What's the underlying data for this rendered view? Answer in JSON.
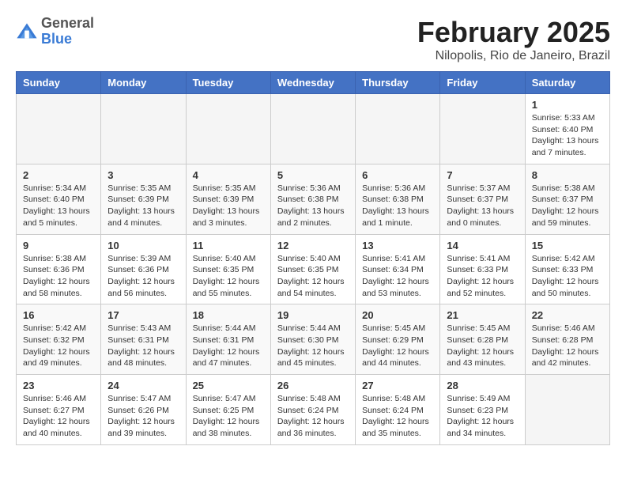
{
  "header": {
    "logo_general": "General",
    "logo_blue": "Blue",
    "title": "February 2025",
    "subtitle": "Nilopolis, Rio de Janeiro, Brazil"
  },
  "weekdays": [
    "Sunday",
    "Monday",
    "Tuesday",
    "Wednesday",
    "Thursday",
    "Friday",
    "Saturday"
  ],
  "weeks": [
    [
      {
        "day": "",
        "info": ""
      },
      {
        "day": "",
        "info": ""
      },
      {
        "day": "",
        "info": ""
      },
      {
        "day": "",
        "info": ""
      },
      {
        "day": "",
        "info": ""
      },
      {
        "day": "",
        "info": ""
      },
      {
        "day": "1",
        "info": "Sunrise: 5:33 AM\nSunset: 6:40 PM\nDaylight: 13 hours and 7 minutes."
      }
    ],
    [
      {
        "day": "2",
        "info": "Sunrise: 5:34 AM\nSunset: 6:40 PM\nDaylight: 13 hours and 5 minutes."
      },
      {
        "day": "3",
        "info": "Sunrise: 5:35 AM\nSunset: 6:39 PM\nDaylight: 13 hours and 4 minutes."
      },
      {
        "day": "4",
        "info": "Sunrise: 5:35 AM\nSunset: 6:39 PM\nDaylight: 13 hours and 3 minutes."
      },
      {
        "day": "5",
        "info": "Sunrise: 5:36 AM\nSunset: 6:38 PM\nDaylight: 13 hours and 2 minutes."
      },
      {
        "day": "6",
        "info": "Sunrise: 5:36 AM\nSunset: 6:38 PM\nDaylight: 13 hours and 1 minute."
      },
      {
        "day": "7",
        "info": "Sunrise: 5:37 AM\nSunset: 6:37 PM\nDaylight: 13 hours and 0 minutes."
      },
      {
        "day": "8",
        "info": "Sunrise: 5:38 AM\nSunset: 6:37 PM\nDaylight: 12 hours and 59 minutes."
      }
    ],
    [
      {
        "day": "9",
        "info": "Sunrise: 5:38 AM\nSunset: 6:36 PM\nDaylight: 12 hours and 58 minutes."
      },
      {
        "day": "10",
        "info": "Sunrise: 5:39 AM\nSunset: 6:36 PM\nDaylight: 12 hours and 56 minutes."
      },
      {
        "day": "11",
        "info": "Sunrise: 5:40 AM\nSunset: 6:35 PM\nDaylight: 12 hours and 55 minutes."
      },
      {
        "day": "12",
        "info": "Sunrise: 5:40 AM\nSunset: 6:35 PM\nDaylight: 12 hours and 54 minutes."
      },
      {
        "day": "13",
        "info": "Sunrise: 5:41 AM\nSunset: 6:34 PM\nDaylight: 12 hours and 53 minutes."
      },
      {
        "day": "14",
        "info": "Sunrise: 5:41 AM\nSunset: 6:33 PM\nDaylight: 12 hours and 52 minutes."
      },
      {
        "day": "15",
        "info": "Sunrise: 5:42 AM\nSunset: 6:33 PM\nDaylight: 12 hours and 50 minutes."
      }
    ],
    [
      {
        "day": "16",
        "info": "Sunrise: 5:42 AM\nSunset: 6:32 PM\nDaylight: 12 hours and 49 minutes."
      },
      {
        "day": "17",
        "info": "Sunrise: 5:43 AM\nSunset: 6:31 PM\nDaylight: 12 hours and 48 minutes."
      },
      {
        "day": "18",
        "info": "Sunrise: 5:44 AM\nSunset: 6:31 PM\nDaylight: 12 hours and 47 minutes."
      },
      {
        "day": "19",
        "info": "Sunrise: 5:44 AM\nSunset: 6:30 PM\nDaylight: 12 hours and 45 minutes."
      },
      {
        "day": "20",
        "info": "Sunrise: 5:45 AM\nSunset: 6:29 PM\nDaylight: 12 hours and 44 minutes."
      },
      {
        "day": "21",
        "info": "Sunrise: 5:45 AM\nSunset: 6:28 PM\nDaylight: 12 hours and 43 minutes."
      },
      {
        "day": "22",
        "info": "Sunrise: 5:46 AM\nSunset: 6:28 PM\nDaylight: 12 hours and 42 minutes."
      }
    ],
    [
      {
        "day": "23",
        "info": "Sunrise: 5:46 AM\nSunset: 6:27 PM\nDaylight: 12 hours and 40 minutes."
      },
      {
        "day": "24",
        "info": "Sunrise: 5:47 AM\nSunset: 6:26 PM\nDaylight: 12 hours and 39 minutes."
      },
      {
        "day": "25",
        "info": "Sunrise: 5:47 AM\nSunset: 6:25 PM\nDaylight: 12 hours and 38 minutes."
      },
      {
        "day": "26",
        "info": "Sunrise: 5:48 AM\nSunset: 6:24 PM\nDaylight: 12 hours and 36 minutes."
      },
      {
        "day": "27",
        "info": "Sunrise: 5:48 AM\nSunset: 6:24 PM\nDaylight: 12 hours and 35 minutes."
      },
      {
        "day": "28",
        "info": "Sunrise: 5:49 AM\nSunset: 6:23 PM\nDaylight: 12 hours and 34 minutes."
      },
      {
        "day": "",
        "info": ""
      }
    ]
  ]
}
